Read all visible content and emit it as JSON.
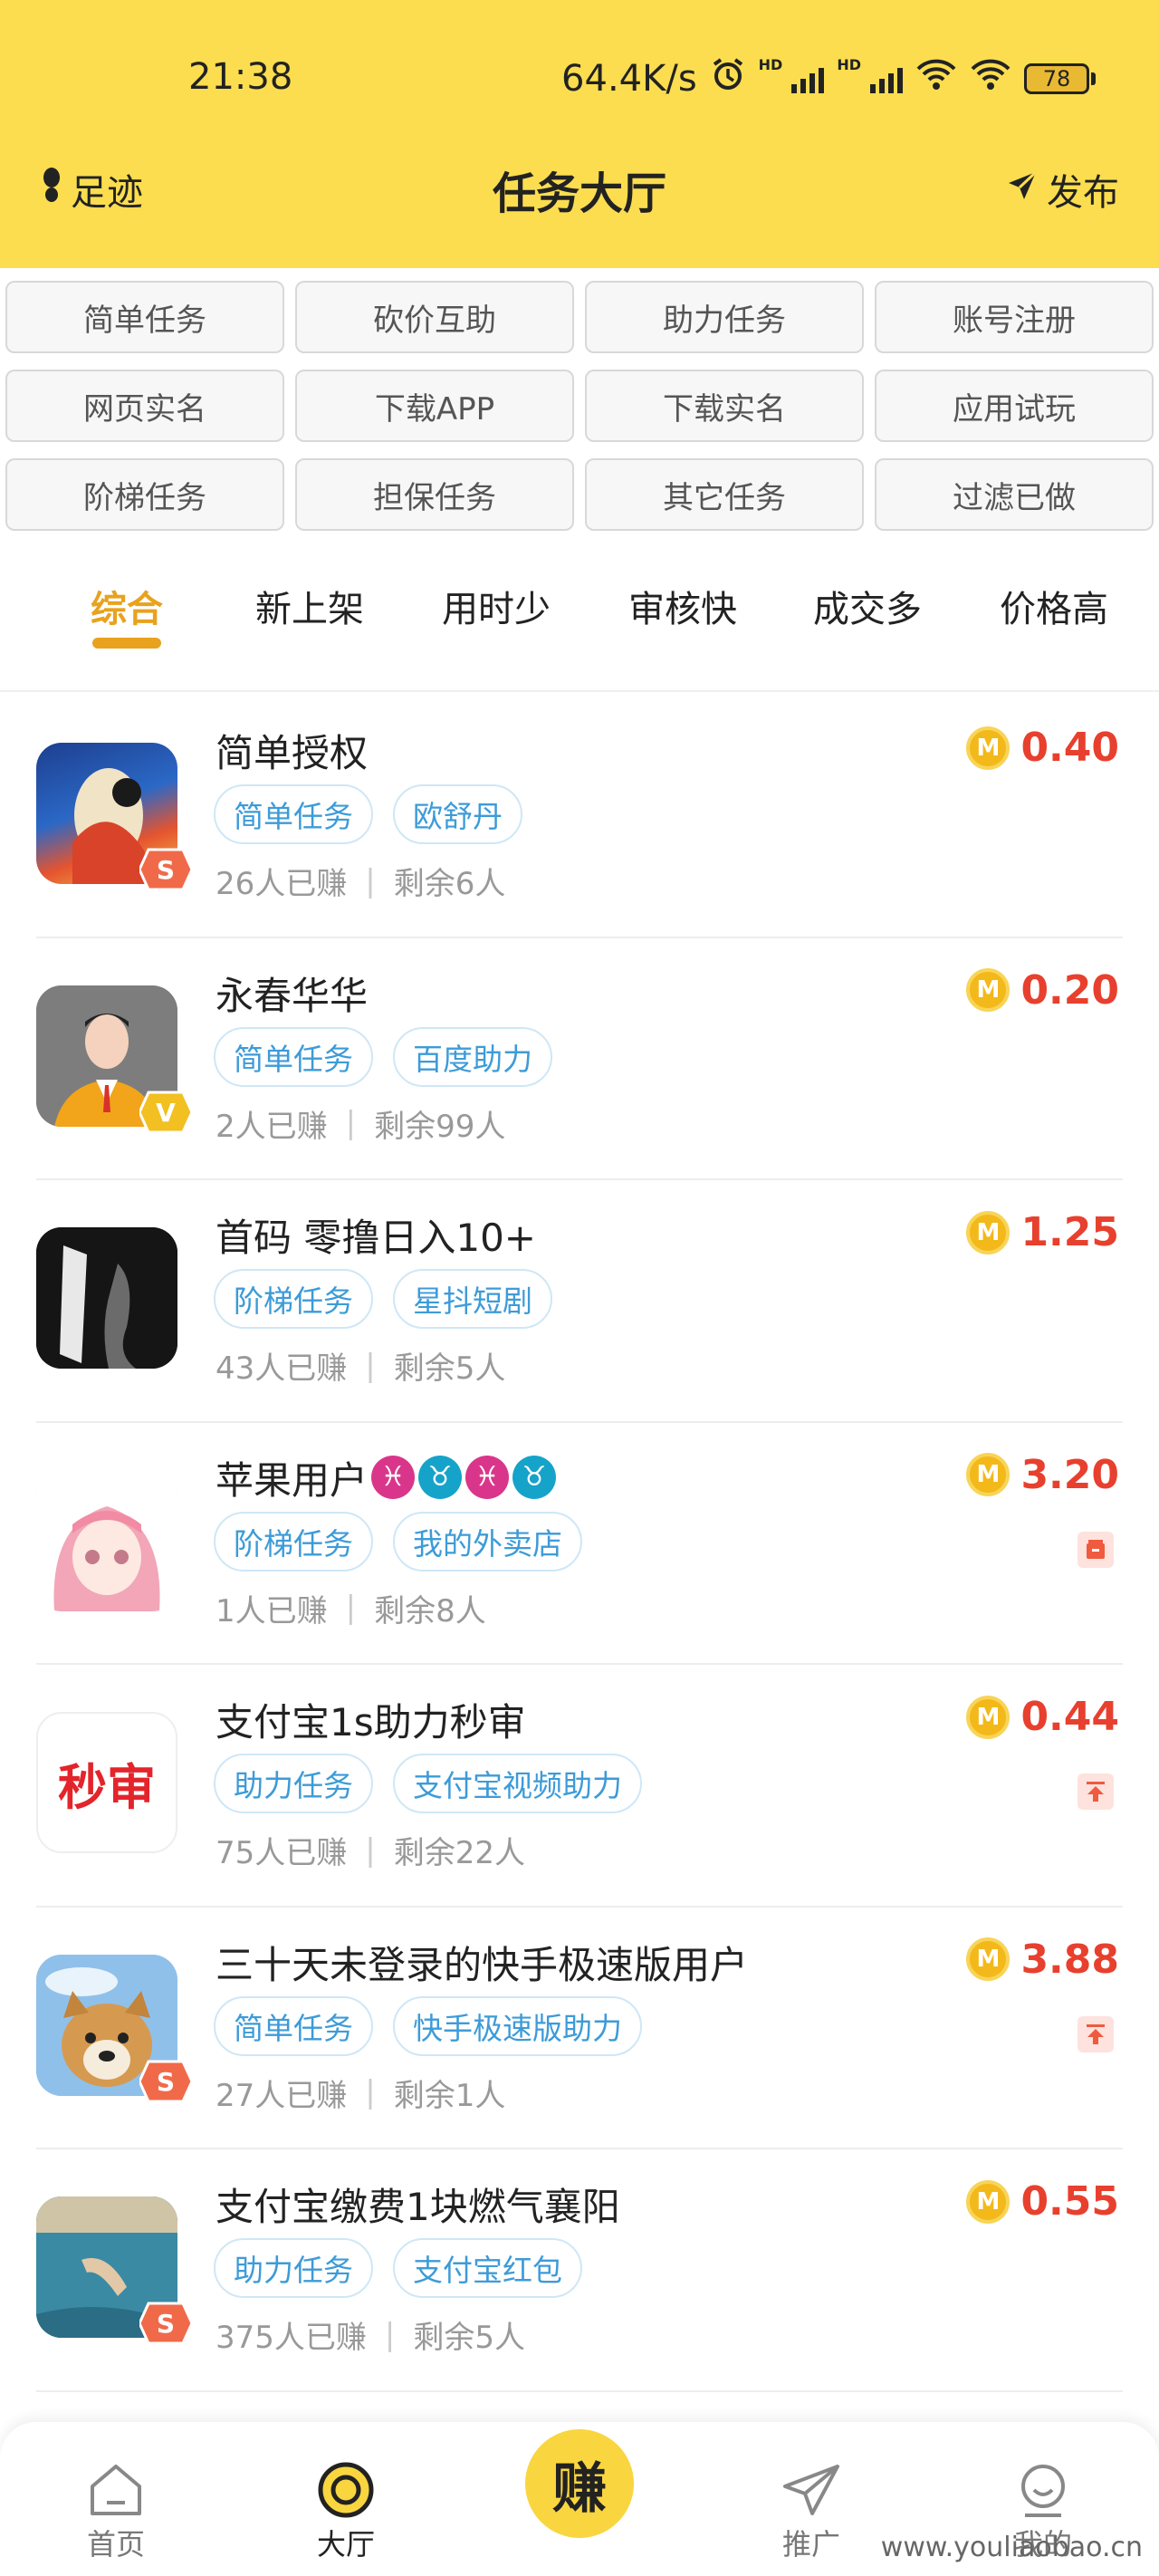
{
  "status": {
    "time": "21:38",
    "speed": "64.4K/s",
    "battery": "78",
    "hd": "HD"
  },
  "header": {
    "left_label": "足迹",
    "title": "任务大厅",
    "right_label": "发布"
  },
  "categories": [
    "简单任务",
    "砍价互助",
    "助力任务",
    "账号注册",
    "网页实名",
    "下载APP",
    "下载实名",
    "应用试玩",
    "阶梯任务",
    "担保任务",
    "其它任务",
    "过滤已做"
  ],
  "sort_tabs": [
    "综合",
    "新上架",
    "用时少",
    "审核快",
    "成交多",
    "价格高"
  ],
  "tasks": [
    {
      "title": "简单授权",
      "tags": [
        "简单任务",
        "欧舒丹"
      ],
      "earned": "26人已赚",
      "remaining": "剩余6人",
      "price": "0.40"
    },
    {
      "title": "永春华华",
      "tags": [
        "简单任务",
        "百度助力"
      ],
      "earned": "2人已赚",
      "remaining": "剩余99人",
      "price": "0.20"
    },
    {
      "title": "首码 零撸日入10+",
      "tags": [
        "阶梯任务",
        "星抖短剧"
      ],
      "earned": "43人已赚",
      "remaining": "剩余5人",
      "price": "1.25"
    },
    {
      "title": "苹果用户",
      "tags": [
        "阶梯任务",
        "我的外卖店"
      ],
      "earned": "1人已赚",
      "remaining": "剩余8人",
      "price": "3.20"
    },
    {
      "title": "支付宝1s助力秒审",
      "tags": [
        "助力任务",
        "支付宝视频助力"
      ],
      "earned": "75人已赚",
      "remaining": "剩余22人",
      "price": "0.44"
    },
    {
      "title": "三十天未登录的快手极速版用户",
      "tags": [
        "简单任务",
        "快手极速版助力"
      ],
      "earned": "27人已赚",
      "remaining": "剩余1人",
      "price": "3.88"
    },
    {
      "title": "支付宝缴费1块燃气襄阳",
      "tags": [
        "助力任务",
        "支付宝红包"
      ],
      "earned": "375人已赚",
      "remaining": "剩余5人",
      "price": "0.55"
    }
  ],
  "avatar_text": {
    "task5": "秒审"
  },
  "badges": {
    "s": "S",
    "v": "V"
  },
  "coin_letter": "M",
  "bottom_nav": {
    "home": "首页",
    "hall": "大厅",
    "earn": "赚",
    "promote": "推广",
    "mine": "我的"
  },
  "watermark": "www.youliaobao.cn",
  "colors": {
    "accent": "#FBDD4F",
    "active_tab": "#E8A21E",
    "price": "#E8402E",
    "tag_text": "#3D9BD8"
  }
}
